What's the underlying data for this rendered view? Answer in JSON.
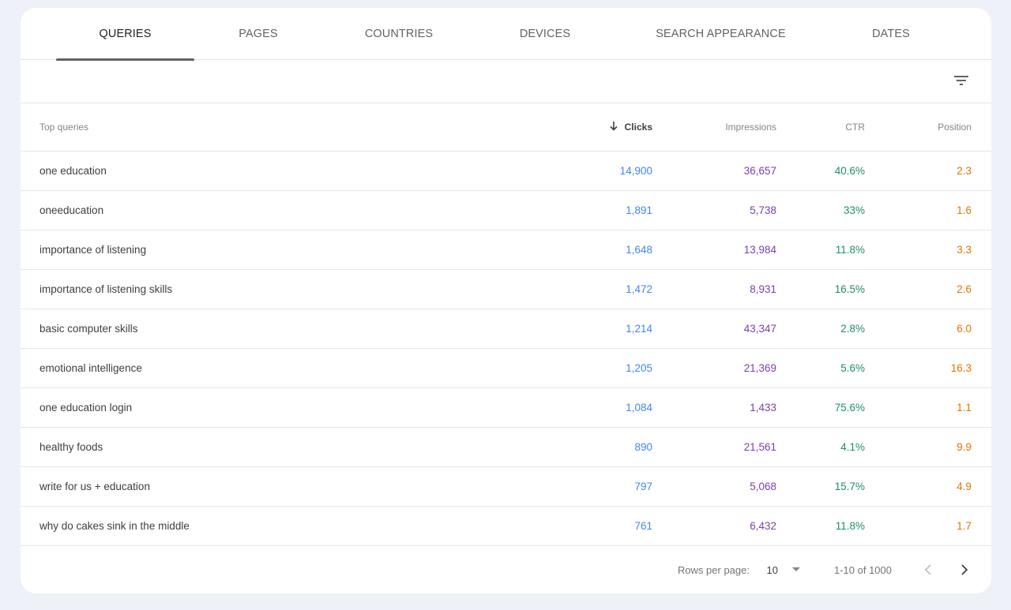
{
  "tabs": [
    "QUERIES",
    "PAGES",
    "COUNTRIES",
    "DEVICES",
    "SEARCH APPEARANCE",
    "DATES"
  ],
  "table": {
    "headers": {
      "query": "Top queries",
      "clicks": "Clicks",
      "impressions": "Impressions",
      "ctr": "CTR",
      "position": "Position"
    },
    "rows": [
      {
        "query": "one education",
        "clicks": "14,900",
        "impressions": "36,657",
        "ctr": "40.6%",
        "position": "2.3"
      },
      {
        "query": "oneeducation",
        "clicks": "1,891",
        "impressions": "5,738",
        "ctr": "33%",
        "position": "1.6"
      },
      {
        "query": "importance of listening",
        "clicks": "1,648",
        "impressions": "13,984",
        "ctr": "11.8%",
        "position": "3.3"
      },
      {
        "query": "importance of listening skills",
        "clicks": "1,472",
        "impressions": "8,931",
        "ctr": "16.5%",
        "position": "2.6"
      },
      {
        "query": "basic computer skills",
        "clicks": "1,214",
        "impressions": "43,347",
        "ctr": "2.8%",
        "position": "6.0"
      },
      {
        "query": "emotional intelligence",
        "clicks": "1,205",
        "impressions": "21,369",
        "ctr": "5.6%",
        "position": "16.3"
      },
      {
        "query": "one education login",
        "clicks": "1,084",
        "impressions": "1,433",
        "ctr": "75.6%",
        "position": "1.1"
      },
      {
        "query": "healthy foods",
        "clicks": "890",
        "impressions": "21,561",
        "ctr": "4.1%",
        "position": "9.9"
      },
      {
        "query": "write for us + education",
        "clicks": "797",
        "impressions": "5,068",
        "ctr": "15.7%",
        "position": "4.9"
      },
      {
        "query": "why do cakes sink in the middle",
        "clicks": "761",
        "impressions": "6,432",
        "ctr": "11.8%",
        "position": "1.7"
      }
    ]
  },
  "pagination": {
    "rows_per_page_label": "Rows per page:",
    "rows_per_page_value": "10",
    "range_text": "1-10 of 1000"
  },
  "icons": {
    "filter": "filter-icon",
    "sort": "arrow-down-icon",
    "caret": "caret-down-icon",
    "prev": "chevron-left-icon",
    "next": "chevron-right-icon"
  },
  "colors": {
    "clicks": "#4285f4",
    "impressions": "#7a3fb0",
    "ctr": "#1f8c6e",
    "position": "#e37400"
  }
}
